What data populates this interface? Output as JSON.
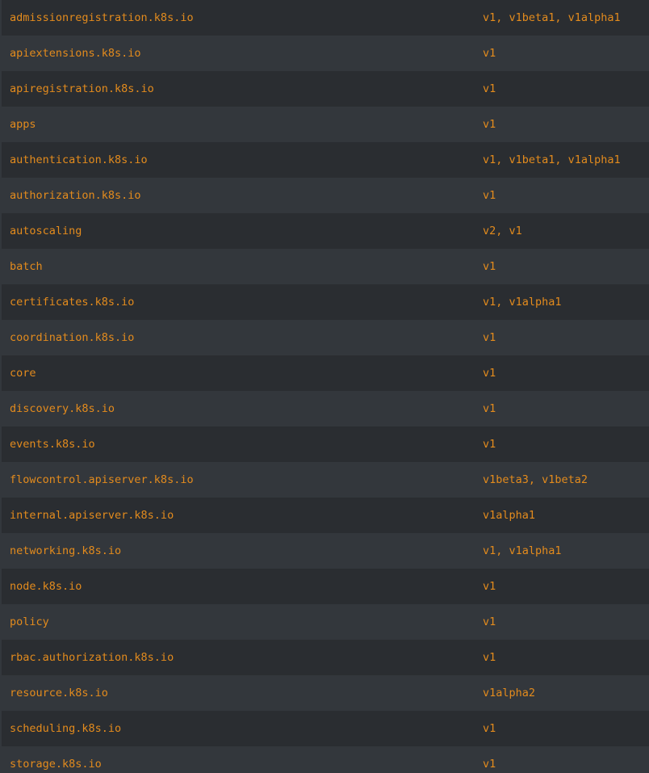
{
  "table": {
    "rows": [
      {
        "group": "admissionregistration.k8s.io",
        "versions": "v1, v1beta1, v1alpha1"
      },
      {
        "group": "apiextensions.k8s.io",
        "versions": "v1"
      },
      {
        "group": "apiregistration.k8s.io",
        "versions": "v1"
      },
      {
        "group": "apps",
        "versions": "v1"
      },
      {
        "group": "authentication.k8s.io",
        "versions": "v1, v1beta1, v1alpha1"
      },
      {
        "group": "authorization.k8s.io",
        "versions": "v1"
      },
      {
        "group": "autoscaling",
        "versions": "v2, v1"
      },
      {
        "group": "batch",
        "versions": "v1"
      },
      {
        "group": "certificates.k8s.io",
        "versions": "v1, v1alpha1"
      },
      {
        "group": "coordination.k8s.io",
        "versions": "v1"
      },
      {
        "group": "core",
        "versions": "v1"
      },
      {
        "group": "discovery.k8s.io",
        "versions": "v1"
      },
      {
        "group": "events.k8s.io",
        "versions": "v1"
      },
      {
        "group": "flowcontrol.apiserver.k8s.io",
        "versions": "v1beta3, v1beta2"
      },
      {
        "group": "internal.apiserver.k8s.io",
        "versions": "v1alpha1"
      },
      {
        "group": "networking.k8s.io",
        "versions": "v1, v1alpha1"
      },
      {
        "group": "node.k8s.io",
        "versions": "v1"
      },
      {
        "group": "policy",
        "versions": "v1"
      },
      {
        "group": "rbac.authorization.k8s.io",
        "versions": "v1"
      },
      {
        "group": "resource.k8s.io",
        "versions": "v1alpha2"
      },
      {
        "group": "scheduling.k8s.io",
        "versions": "v1"
      },
      {
        "group": "storage.k8s.io",
        "versions": "v1"
      }
    ]
  },
  "colors": {
    "text": "#e38b1d",
    "row_odd": "#2a2d31",
    "row_even": "#33373c"
  }
}
